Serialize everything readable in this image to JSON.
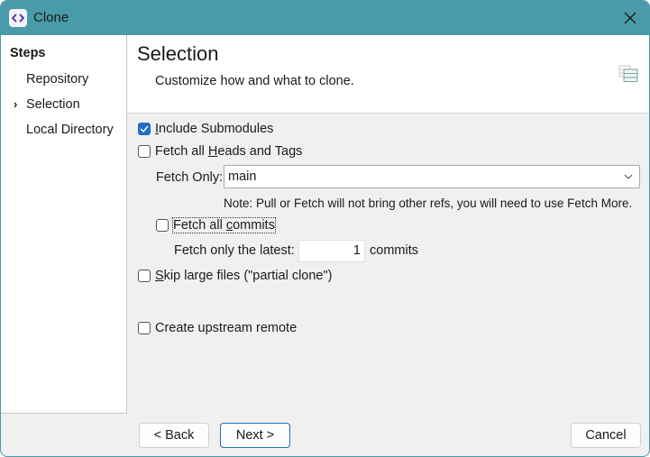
{
  "window": {
    "title": "Clone",
    "app_icon": "code-brackets-icon",
    "close_icon": "close-icon"
  },
  "sidebar": {
    "title": "Steps",
    "items": [
      {
        "label": "Repository",
        "current": false
      },
      {
        "label": "Selection",
        "current": true
      },
      {
        "label": "Local Directory",
        "current": false
      }
    ],
    "current_marker": "›"
  },
  "header": {
    "title": "Selection",
    "subtitle": "Customize how and what to clone.",
    "icon": "stacked-list-icon"
  },
  "options": {
    "include_submodules": {
      "label_pre": "",
      "mnemonic": "I",
      "label_post": "nclude Submodules",
      "checked": true
    },
    "fetch_all_heads": {
      "label_pre": "Fetch all ",
      "mnemonic": "H",
      "label_post": "eads and Tags",
      "checked": false
    },
    "fetch_only": {
      "label": "Fetch Only:",
      "value": "main"
    },
    "note": "Note: Pull or Fetch will not bring other refs, you will need to use Fetch More.",
    "fetch_all_commits": {
      "label_pre": "Fetch all ",
      "mnemonic": "c",
      "label_post": "ommits",
      "checked": false
    },
    "fetch_latest": {
      "label": "Fetch only the latest:",
      "value": "1",
      "suffix": "commits"
    },
    "skip_large_files": {
      "label_pre": "",
      "mnemonic": "S",
      "label_post": "kip large files (\"partial clone\")",
      "checked": false
    },
    "create_upstream_remote": {
      "label": "Create upstream remote",
      "checked": false
    }
  },
  "footer": {
    "back_label": "< Back",
    "next_label": "Next >",
    "cancel_label": "Cancel"
  }
}
